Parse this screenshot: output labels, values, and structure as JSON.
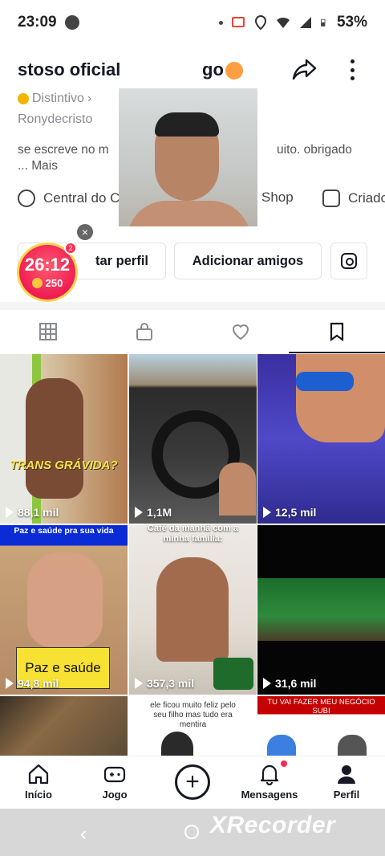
{
  "status": {
    "time": "23:09",
    "battery": "53%"
  },
  "profile": {
    "username_visible": "stoso oficial",
    "username_tail": "go",
    "badge_label": "Distintivo",
    "handle": "Ronydecristo",
    "bio_left": "se escreve no m",
    "bio_right": "uito. obrigado",
    "bio_more": "...  Mais"
  },
  "links": {
    "creator_central": "Central do C",
    "shop": "Shop",
    "creator": "Criado"
  },
  "actions": {
    "edit_profile": "tar perfil",
    "add_friends": "Adicionar amigos"
  },
  "timer": {
    "time": "26:12",
    "coins": "250",
    "badge": "2"
  },
  "videos": [
    {
      "views": "88,1 mil",
      "caption": "TRANS GRÁVIDA?"
    },
    {
      "views": "1,1M",
      "caption": ""
    },
    {
      "views": "12,5 mil",
      "caption": ""
    },
    {
      "views": "94,8 mil",
      "caption": "Paz e saúde pra sua vida",
      "sticker": "Paz e saúde"
    },
    {
      "views": "357,3 mil",
      "caption": "Café da manhã com a minha família:"
    },
    {
      "views": "31,6 mil",
      "caption": ""
    },
    {
      "views": "",
      "caption": ""
    },
    {
      "views": "",
      "caption": "ele ficou muito feliz pelo seu filho mas tudo era mentira"
    },
    {
      "views": "",
      "caption": "TU VAI FAZER MEU NEGÓCIO SUBI KKKKKKKKKKKKKKKKKKKK"
    }
  ],
  "nav": {
    "home": "Início",
    "game": "Jogo",
    "messages": "Mensagens",
    "profile": "Perfil"
  },
  "watermark": "XRecorder"
}
